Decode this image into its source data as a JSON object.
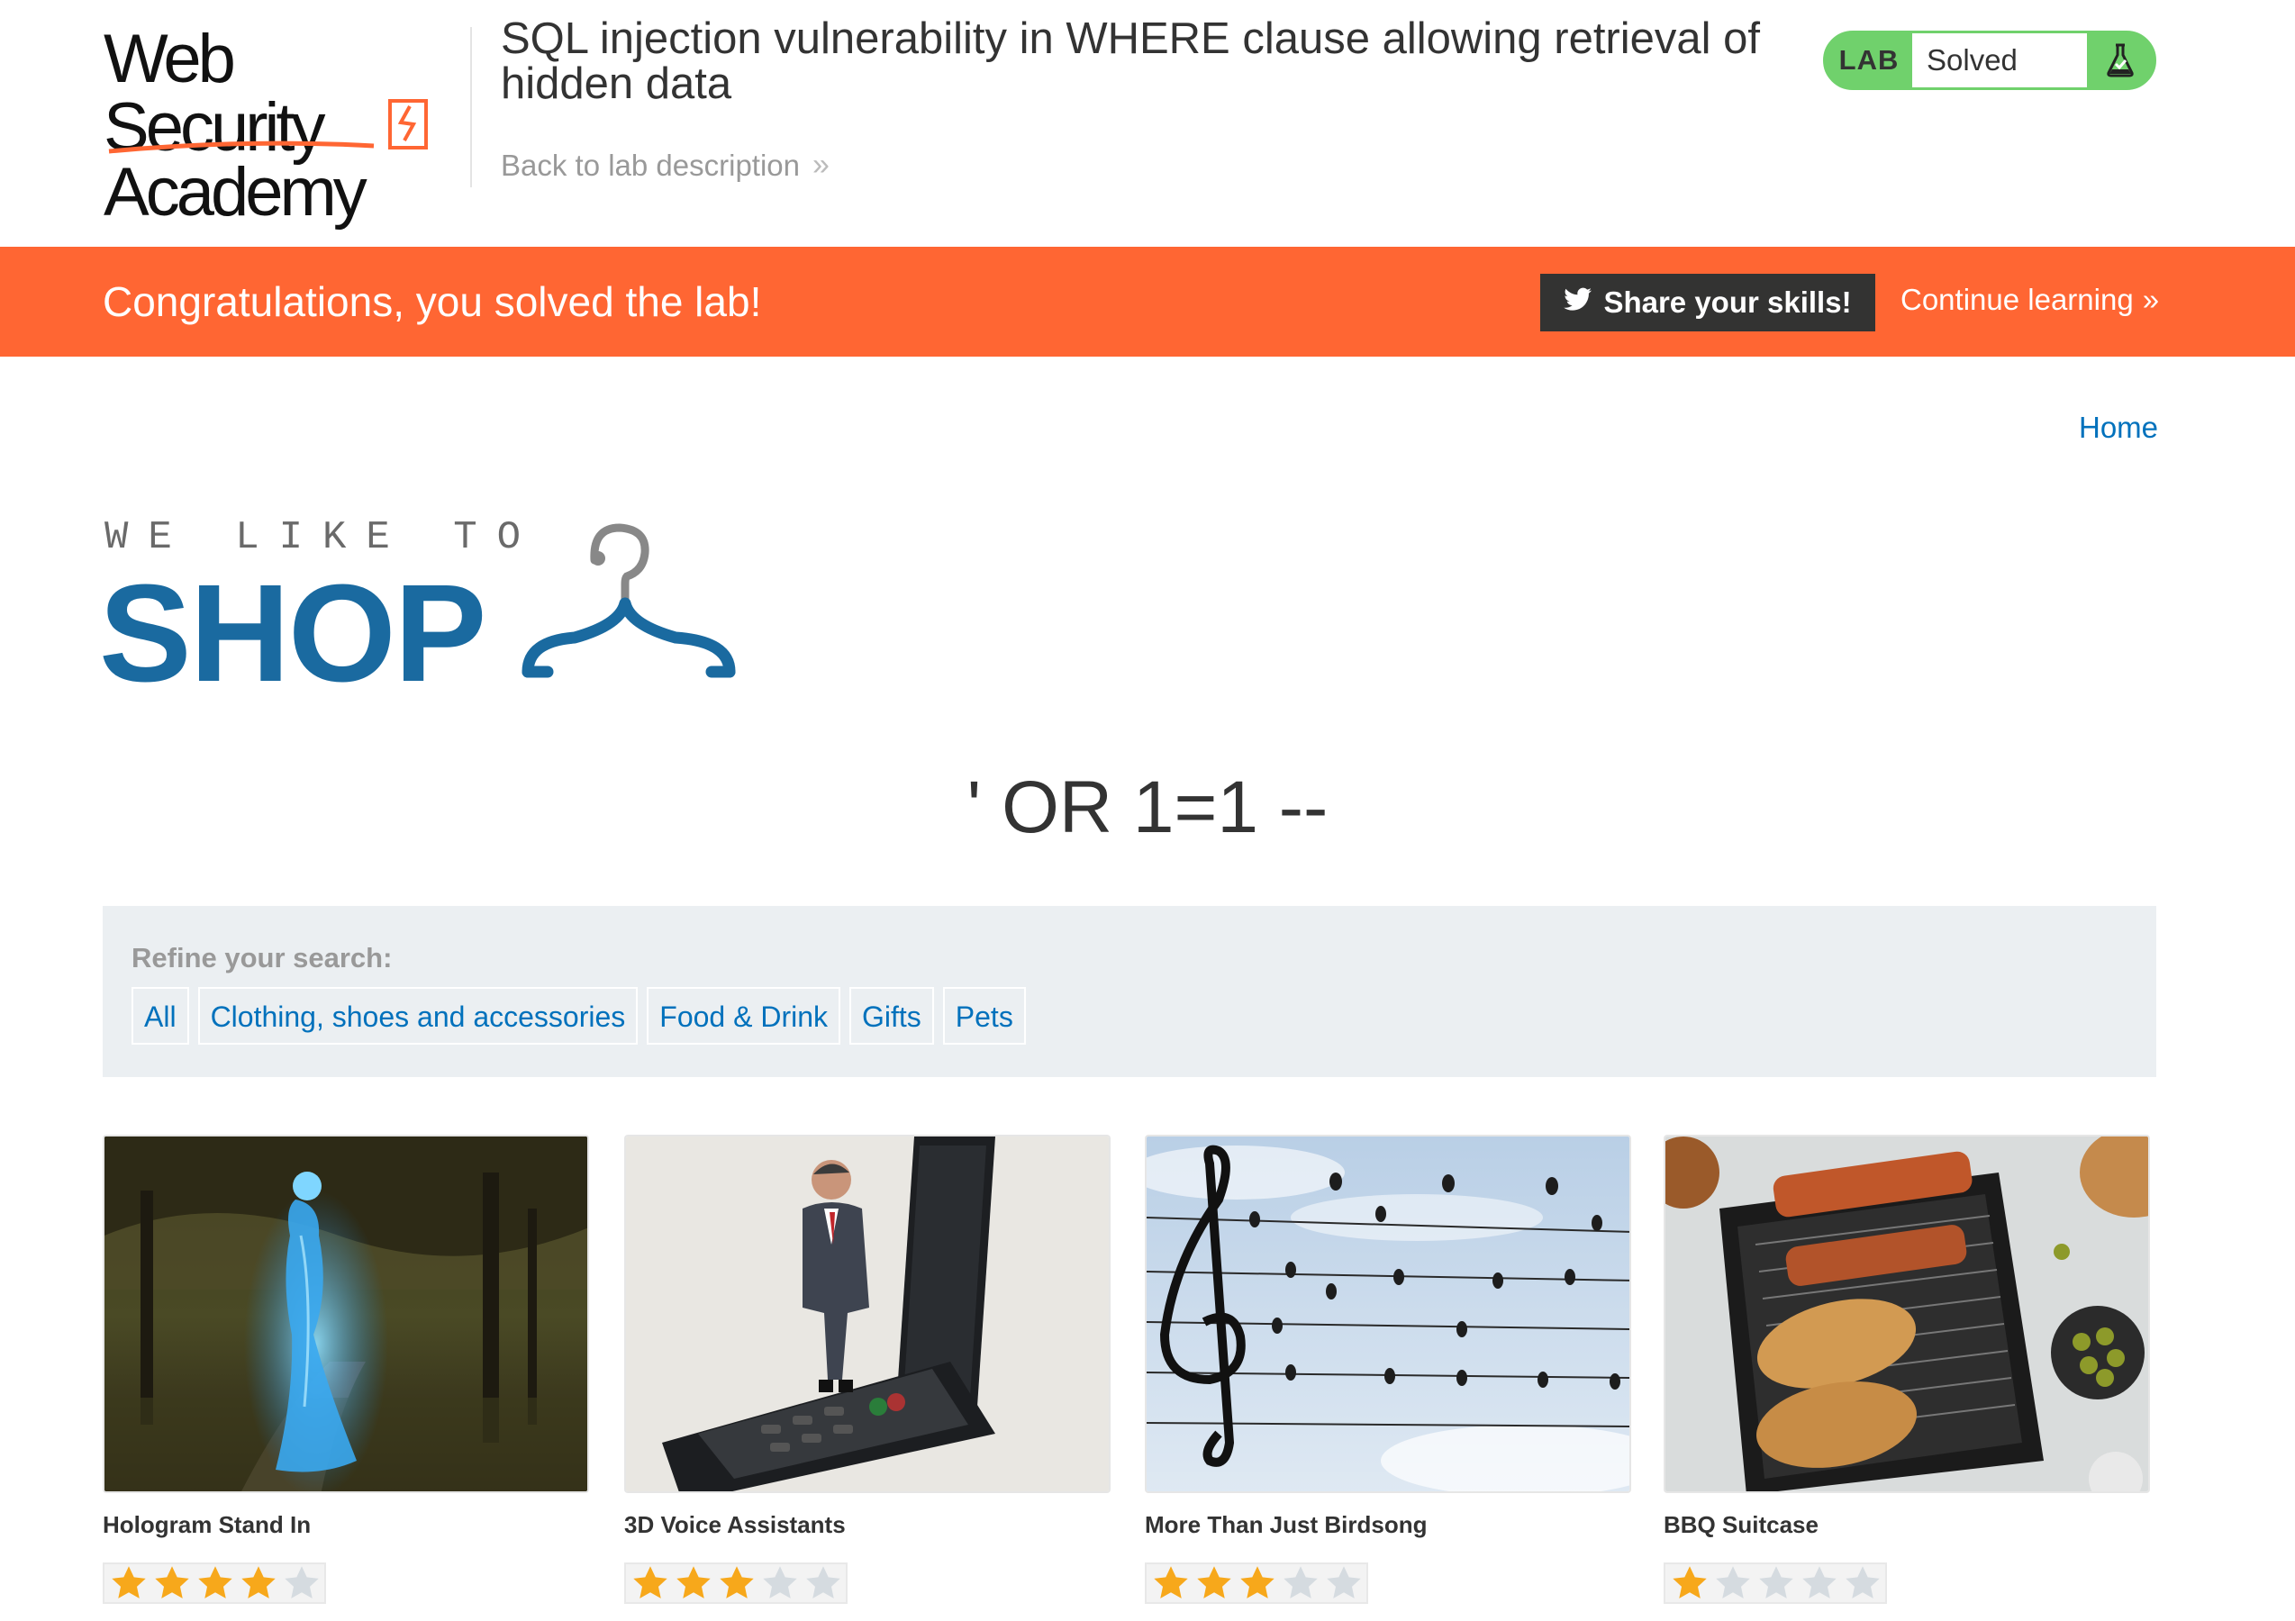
{
  "header": {
    "logo_line1": "Web Security",
    "logo_line2": "Academy",
    "lab_title": "SQL injection vulnerability in WHERE clause allowing retrieval of hidden data",
    "back_link": "Back to lab description",
    "lab_tag": "LAB",
    "lab_status": "Solved"
  },
  "banner": {
    "message": "Congratulations, you solved the lab!",
    "share_button": "Share your skills!",
    "continue_link": "Continue learning"
  },
  "nav": {
    "home": "Home"
  },
  "shop_logo": {
    "small": "WE LIKE TO",
    "big": "SHOP"
  },
  "search": {
    "heading": "' OR 1=1 --"
  },
  "filter": {
    "label": "Refine your search:",
    "categories": [
      "All",
      "Clothing, shoes and accessories",
      "Food & Drink",
      "Gifts",
      "Pets"
    ]
  },
  "products": [
    {
      "name": "Hologram Stand In",
      "rating": 4,
      "max_rating": 5
    },
    {
      "name": "3D Voice Assistants",
      "rating": 3,
      "max_rating": 5
    },
    {
      "name": "More Than Just Birdsong",
      "rating": 3,
      "max_rating": 5
    },
    {
      "name": "BBQ Suitcase",
      "rating": 1,
      "max_rating": 5
    }
  ],
  "colors": {
    "accent_orange": "#ff6633",
    "lab_green": "#70d16c",
    "link_blue": "#0071bc",
    "shop_blue": "#1a6aa0",
    "star_gold": "#f7a81b",
    "star_empty": "#d5dbe0"
  }
}
